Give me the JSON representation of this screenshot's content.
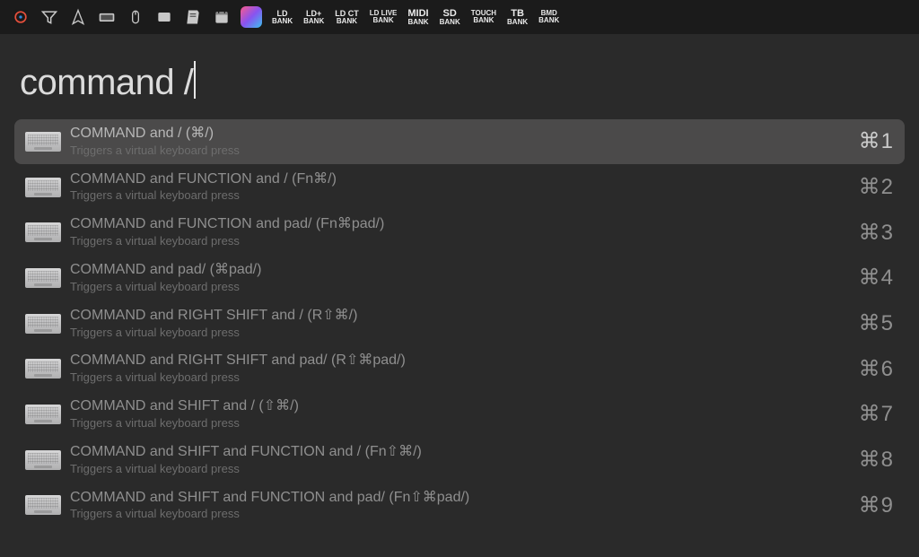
{
  "menubar": {
    "banks": [
      {
        "top": "LD",
        "bottom": "BANK"
      },
      {
        "top": "LD+",
        "bottom": "BANK"
      },
      {
        "top": "LD CT",
        "bottom": "BANK"
      },
      {
        "top": "LD LIVE",
        "bottom": "BANK"
      },
      {
        "top": "MIDI",
        "bottom": "BANK"
      },
      {
        "top": "SD",
        "bottom": "BANK"
      },
      {
        "top": "TOUCH",
        "bottom": "BANK"
      },
      {
        "top": "TB",
        "bottom": "BANK"
      },
      {
        "top": "BMD",
        "bottom": "BANK"
      }
    ]
  },
  "search": {
    "query": "command /"
  },
  "results": [
    {
      "title": "COMMAND and / (⌘/)",
      "subtitle": "Triggers a virtual keyboard press",
      "shortcut": "⌘1",
      "selected": true
    },
    {
      "title": "COMMAND and FUNCTION and / (Fn⌘/)",
      "subtitle": "Triggers a virtual keyboard press",
      "shortcut": "⌘2",
      "selected": false
    },
    {
      "title": "COMMAND and FUNCTION and pad/ (Fn⌘pad/)",
      "subtitle": "Triggers a virtual keyboard press",
      "shortcut": "⌘3",
      "selected": false
    },
    {
      "title": "COMMAND and pad/ (⌘pad/)",
      "subtitle": "Triggers a virtual keyboard press",
      "shortcut": "⌘4",
      "selected": false
    },
    {
      "title": "COMMAND and RIGHT SHIFT and / (R⇧⌘/)",
      "subtitle": "Triggers a virtual keyboard press",
      "shortcut": "⌘5",
      "selected": false
    },
    {
      "title": "COMMAND and RIGHT SHIFT and pad/ (R⇧⌘pad/)",
      "subtitle": "Triggers a virtual keyboard press",
      "shortcut": "⌘6",
      "selected": false
    },
    {
      "title": "COMMAND and SHIFT and / (⇧⌘/)",
      "subtitle": "Triggers a virtual keyboard press",
      "shortcut": "⌘7",
      "selected": false
    },
    {
      "title": "COMMAND and SHIFT and FUNCTION and / (Fn⇧⌘/)",
      "subtitle": "Triggers a virtual keyboard press",
      "shortcut": "⌘8",
      "selected": false
    },
    {
      "title": "COMMAND and SHIFT and FUNCTION and pad/ (Fn⇧⌘pad/)",
      "subtitle": "Triggers a virtual keyboard press",
      "shortcut": "⌘9",
      "selected": false
    }
  ]
}
